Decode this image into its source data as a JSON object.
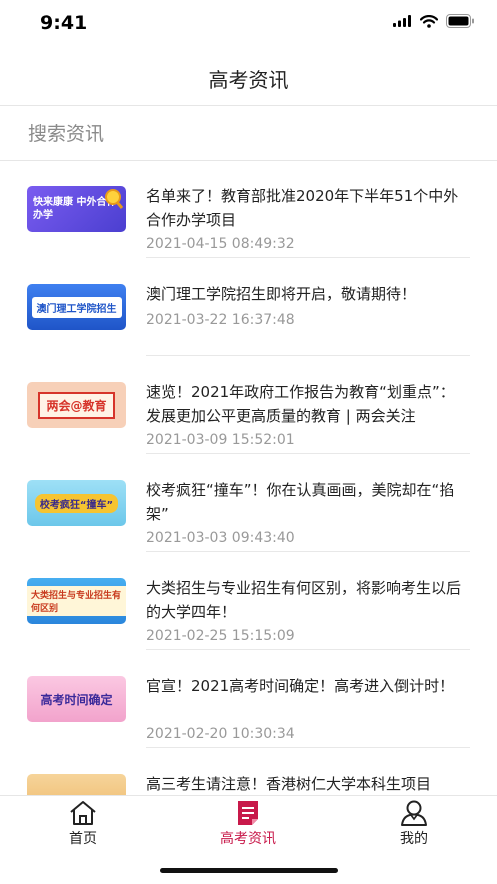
{
  "status_bar": {
    "time": "9:41"
  },
  "nav": {
    "title": "高考资讯"
  },
  "search": {
    "placeholder": "搜索资讯"
  },
  "news": [
    {
      "title": "名单来了！教育部批准2020年下半年51个中外合作办学项目",
      "time": "2021-04-15 08:49:32",
      "thumb_text": "快来康康 中外合作办学",
      "thumb_bg": "#6a5ce0"
    },
    {
      "title": "澳门理工学院招生即将开启，敬请期待！",
      "time": "2021-03-22 16:37:48",
      "thumb_text": "澳门理工学院招生",
      "thumb_bg": "#2f6fe0"
    },
    {
      "title": "速览！2021年政府工作报告为教育“划重点”：发展更加公平更高质量的教育 | 两会关注",
      "time": "2021-03-09 15:52:01",
      "thumb_text": "两会@教育",
      "thumb_bg": "#f4c4a8"
    },
    {
      "title": "校考疯狂“撞车”！你在认真画画，美院却在“掐架”",
      "time": "2021-03-03 09:43:40",
      "thumb_text": "校考疯狂“撞车”",
      "thumb_bg": "#8fd6f0"
    },
    {
      "title": "大类招生与专业招生有何区别，将影响考生以后的大学四年！",
      "time": "2021-02-25 15:15:09",
      "thumb_text": "大类招生与专业招生有何区别",
      "thumb_bg": "#3aa0ea"
    },
    {
      "title": "官宣！2021高考时间确定！高考进入倒计时！",
      "time": "2021-02-20 10:30:34",
      "thumb_text": "高考时间确定",
      "thumb_bg": "#f6b8d8"
    },
    {
      "title": "高三考生请注意！香港树仁大学本科生项目",
      "time": "",
      "thumb_text": "",
      "thumb_bg": "#f3c98a"
    }
  ],
  "tabs": [
    {
      "label": "首页",
      "icon": "home-icon",
      "active": false
    },
    {
      "label": "高考资讯",
      "icon": "article-icon",
      "active": true
    },
    {
      "label": "我的",
      "icon": "user-icon",
      "active": false
    }
  ],
  "colors": {
    "accent": "#c8194a",
    "inactive": "#222222",
    "time_gray": "#999999"
  }
}
